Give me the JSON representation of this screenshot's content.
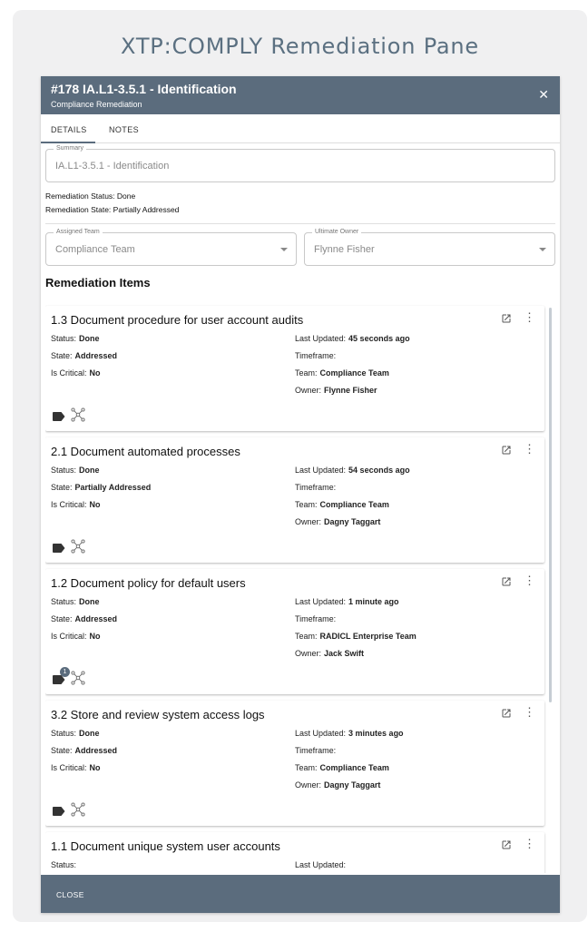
{
  "page_title": "XTP:COMPLY Remediation Pane",
  "dialog": {
    "title": "#178 IA.L1-3.5.1 - Identification",
    "subtitle": "Compliance Remediation",
    "close_glyph": "✕",
    "icon": "close-icon"
  },
  "tabs": [
    {
      "label": "DETAILS",
      "active": true
    },
    {
      "label": "NOTES",
      "active": false
    }
  ],
  "summary": {
    "label": "Summary",
    "value": "IA.L1-3.5.1 - Identification"
  },
  "remediation_status": "Remediation Status: Done",
  "remediation_state": "Remediation State: Partially Addressed",
  "assigned_team": {
    "label": "Assigned Team",
    "value": "Compliance Team"
  },
  "ultimate_owner": {
    "label": "Ultimate Owner",
    "value": "Flynne Fisher"
  },
  "section_title": "Remediation Items",
  "labels": {
    "status": "Status:",
    "state": "State:",
    "critical": "Is Critical:",
    "updated": "Last Updated:",
    "timeframe": "Timeframe:",
    "team": "Team:",
    "owner": "Owner:"
  },
  "items": [
    {
      "title": "1.3 Document procedure for user account audits",
      "status": "Done",
      "state": "Addressed",
      "critical": "No",
      "updated": "45 seconds ago",
      "timeframe": "",
      "team": "Compliance Team",
      "owner": "Flynne Fisher",
      "badge": ""
    },
    {
      "title": "2.1 Document automated processes",
      "status": "Done",
      "state": "Partially Addressed",
      "critical": "No",
      "updated": "54 seconds ago",
      "timeframe": "",
      "team": "Compliance Team",
      "owner": "Dagny Taggart",
      "badge": ""
    },
    {
      "title": "1.2 Document policy for default users",
      "status": "Done",
      "state": "Addressed",
      "critical": "No",
      "updated": "1 minute ago",
      "timeframe": "",
      "team": "RADICL Enterprise Team",
      "owner": "Jack Swift",
      "badge": "1"
    },
    {
      "title": "3.2 Store and review system access logs",
      "status": "Done",
      "state": "Addressed",
      "critical": "No",
      "updated": "3 minutes ago",
      "timeframe": "",
      "team": "Compliance Team",
      "owner": "Dagny Taggart",
      "badge": ""
    },
    {
      "title": "1.1 Document unique system user accounts",
      "status": "",
      "state": "",
      "critical": "",
      "updated": "",
      "timeframe": "",
      "team": "",
      "owner": "",
      "badge": ""
    }
  ],
  "item_icons": {
    "open": "open-in-new-icon",
    "menu": "more-vert-icon",
    "label": "label-tag-icon",
    "network": "network-nodes-icon",
    "menu_glyph": "⋮"
  },
  "footer": {
    "close_label": "CLOSE"
  },
  "colors": {
    "header": "#5b6c7d",
    "title": "#5b7081"
  }
}
